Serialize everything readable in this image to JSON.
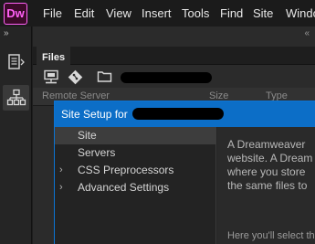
{
  "app": {
    "logo_text": "Dw",
    "logo_color": "#ff61f6"
  },
  "menu": {
    "items": [
      "File",
      "Edit",
      "View",
      "Insert",
      "Tools",
      "Find",
      "Site",
      "Window"
    ]
  },
  "left_toolbar": {
    "collapse_label": "»",
    "tools": [
      {
        "icon": "properties-panel-icon"
      },
      {
        "icon": "site-map-icon",
        "active": true
      }
    ]
  },
  "files_panel": {
    "tab_label": "Files",
    "collapse_label": "«",
    "toolbar_icons": [
      "connect-remote-icon",
      "git-icon",
      "folder-icon"
    ],
    "columns": [
      "Remote Server",
      "Size",
      "Type"
    ]
  },
  "site_setup_dialog": {
    "title": "Site Setup for",
    "nav_items": [
      {
        "label": "Site",
        "selected": true,
        "expandable": false
      },
      {
        "label": "Servers",
        "selected": false,
        "expandable": false
      },
      {
        "label": "CSS Preprocessors",
        "selected": false,
        "expandable": true
      },
      {
        "label": "Advanced Settings",
        "selected": false,
        "expandable": true
      }
    ],
    "description_lines": [
      "A Dreamweaver",
      "website. A Dream",
      "where you store",
      "the same files to"
    ],
    "description_footer": "Here you'll select th",
    "accent_color": "#0c6ec7"
  }
}
